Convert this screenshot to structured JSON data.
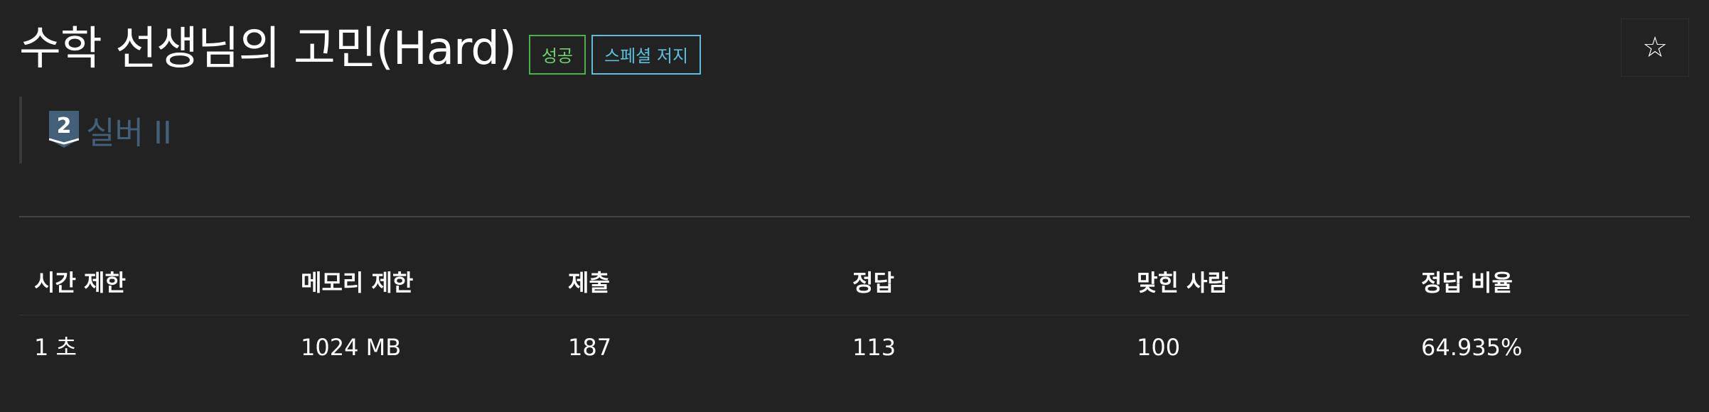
{
  "problem": {
    "title": "수학 선생님의 고민(Hard)",
    "badges": {
      "success": "성공",
      "special_judge": "스페셜 저지"
    },
    "star_icon": "☆",
    "tier": {
      "icon": "silver-tier-icon",
      "level": "2",
      "label": "실버 II",
      "color": "#435f7a"
    }
  },
  "stats": {
    "headers": [
      "시간 제한",
      "메모리 제한",
      "제출",
      "정답",
      "맞힌 사람",
      "정답 비율"
    ],
    "values": [
      "1 초",
      "1024 MB",
      "187",
      "113",
      "100",
      "64.935%"
    ]
  },
  "colors": {
    "background": "#222222",
    "success": "#6fd06f",
    "special_judge": "#5bc0de",
    "tier_silver": "#435f7a"
  }
}
